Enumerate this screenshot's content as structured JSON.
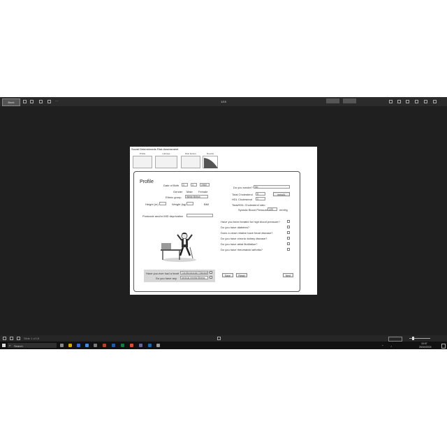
{
  "titlebar": {
    "back_button": "Back",
    "title": "1/19"
  },
  "slide": {
    "title": "Social Determinants Risk Assessment",
    "thumbnails": [
      "Profile",
      "Lifestyle",
      "Risk factors",
      "Results"
    ]
  },
  "form": {
    "heading": "Profile",
    "dob_label": "Date of Birth",
    "dob": {
      "month": "1",
      "day": "1",
      "year": "1960"
    },
    "gender_label": "Gender",
    "gender_options": [
      "Male",
      "Female"
    ],
    "ethnic_label": "Ethnic group",
    "ethnic_value": "White British",
    "height_label": "Height (m)",
    "weight_label": "Weight (kg)",
    "bmi_label": "BMI",
    "postcode_label": "Postcode and/or IMD deprivation",
    "smoker_label": "Do you smoke?",
    "smoker_value": "No",
    "cholesterol_label": "Total Cholesterol",
    "cholesterol_value": "5",
    "cholesterol_unit": "mmol/L",
    "hdl_label": "HDL Cholesterol",
    "hdl_value": "1",
    "ratio_label": "Total/HDL Cholesterol ratio",
    "bp_label": "Systolic Blood Pressure",
    "bp_value": "120",
    "bp_unit": "mmHg",
    "questions": [
      "Have you been treated for high blood pressure?",
      "Do you have diabetes?",
      "Does a close relative have heart disease?",
      "Do you have chronic kidney disease?",
      "Do you have atrial fibrillation?",
      "Do you have rheumatoid arthritis?"
    ],
    "buttons": {
      "save": "Save",
      "reset": "Reset",
      "next": "Next"
    },
    "bottom_box": [
      {
        "label": "Have you ever had a heart",
        "value": "Cardiovascular Disease"
      },
      {
        "label": "Do you have any",
        "value": "serious mental illness"
      }
    ]
  },
  "statusbar": {
    "slide_info": "Slide 1 of 19"
  },
  "taskbar": {
    "search_placeholder": "Search",
    "time": "10:07",
    "date": "26/04/2024"
  }
}
